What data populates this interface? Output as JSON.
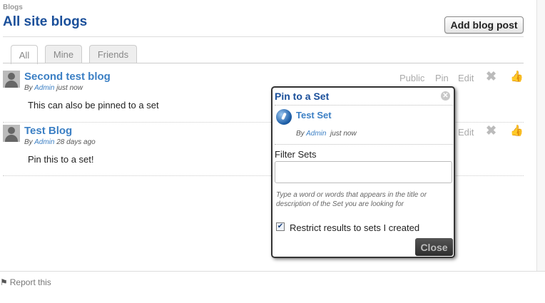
{
  "breadcrumb": "Blogs",
  "page_title": "All site blogs",
  "add_button_label": "Add blog post",
  "tabs": [
    {
      "label": "All",
      "active": true
    },
    {
      "label": "Mine",
      "active": false
    },
    {
      "label": "Friends",
      "active": false
    }
  ],
  "posts": [
    {
      "title": "Second test blog",
      "by": "By",
      "author": "Admin",
      "time": "just now",
      "excerpt": "This can also be pinned to a set",
      "actions": {
        "public": "Public",
        "pin": "Pin",
        "edit": "Edit"
      }
    },
    {
      "title": "Test Blog",
      "by": "By",
      "author": "Admin",
      "time": "28 days ago",
      "excerpt": "Pin this to a set!",
      "actions": {
        "edit": "Edit"
      }
    }
  ],
  "report_label": "Report this",
  "popup": {
    "title": "Pin to a Set",
    "set": {
      "name": "Test Set",
      "by": "By",
      "author": "Admin",
      "time": "just now"
    },
    "filter_label": "Filter Sets",
    "filter_value": "",
    "hint": "Type a word or words that appears in the title or description of the Set you are looking for",
    "restrict_label": "Restrict results to sets I created",
    "restrict_checked": true,
    "close_label": "Close"
  },
  "colors": {
    "title_blue": "#1a4f9a",
    "link_blue": "#3b7fc4"
  }
}
